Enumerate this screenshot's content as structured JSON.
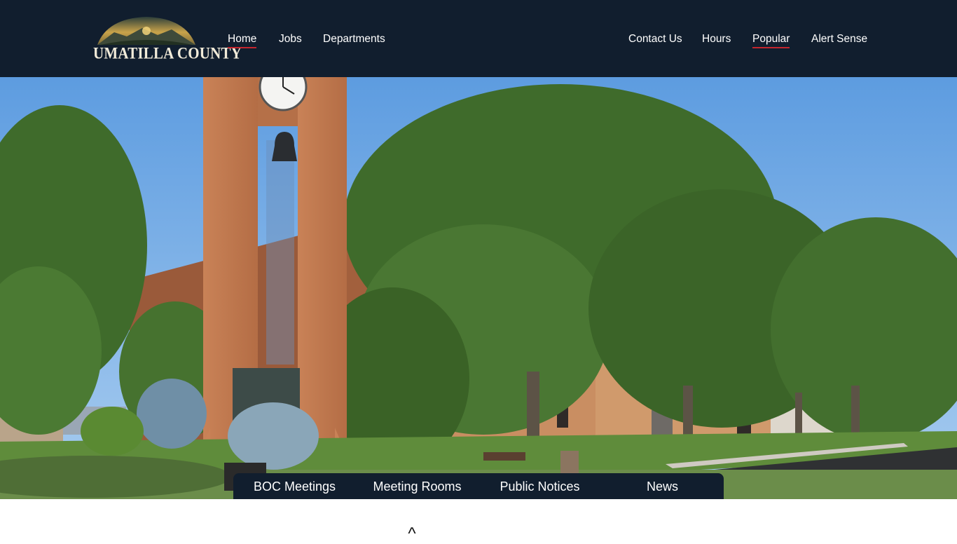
{
  "header": {
    "logo_text": "UMATILLA COUNTY",
    "nav_left": [
      {
        "label": "Home"
      },
      {
        "label": "Jobs"
      },
      {
        "label": "Departments"
      }
    ],
    "nav_right": [
      {
        "label": "Contact Us"
      },
      {
        "label": "Hours"
      },
      {
        "label": "Popular"
      },
      {
        "label": "Alert Sense"
      }
    ]
  },
  "quick_links": [
    {
      "label": "BOC Meetings"
    },
    {
      "label": "Meeting Rooms"
    },
    {
      "label": "Public Notices"
    },
    {
      "label": "News"
    }
  ],
  "scroll_caret": "^",
  "colors": {
    "header_bg": "#111e2e",
    "accent_underline": "#c4262e",
    "link_text": "#ffffff"
  }
}
